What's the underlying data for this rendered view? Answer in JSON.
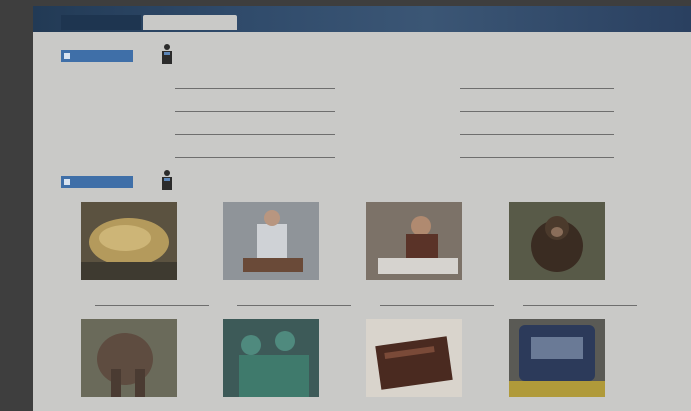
{
  "header": {
    "tab1": "",
    "tab2": ""
  },
  "exercises": [
    {
      "label": "",
      "instruction": ""
    },
    {
      "label": "",
      "instruction": ""
    }
  ],
  "word_pairs": [
    {
      "article": "",
      "answer": ""
    },
    {
      "article": "",
      "answer": ""
    },
    {
      "article": "",
      "answer": ""
    },
    {
      "article": "",
      "answer": ""
    },
    {
      "article": "",
      "answer": ""
    },
    {
      "article": "",
      "answer": ""
    },
    {
      "article": "",
      "answer": ""
    },
    {
      "article": "",
      "answer": ""
    }
  ],
  "photos": [
    {
      "article": "",
      "answer": ""
    },
    {
      "article": "",
      "answer": ""
    },
    {
      "article": "",
      "answer": ""
    },
    {
      "article": "",
      "answer": ""
    },
    {
      "article": "",
      "answer": ""
    },
    {
      "article": "",
      "answer": ""
    },
    {
      "article": "",
      "answer": ""
    },
    {
      "article": "",
      "answer": ""
    }
  ]
}
